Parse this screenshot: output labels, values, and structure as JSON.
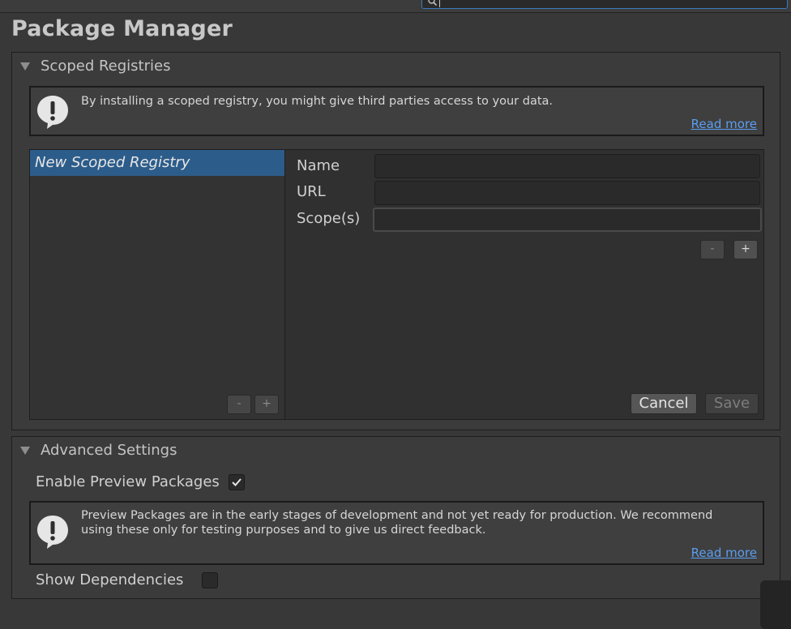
{
  "page": {
    "title": "Package Manager"
  },
  "scoped_registries": {
    "title": "Scoped Registries",
    "help_text": "By installing a scoped registry, you might give third parties access to your data.",
    "read_more": "Read more",
    "list": [
      {
        "label": "New Scoped Registry",
        "selected": true
      }
    ],
    "list_remove": "-",
    "list_add": "+",
    "fields": {
      "name_label": "Name",
      "name_value": "",
      "url_label": "URL",
      "url_value": "",
      "scopes_label": "Scope(s)",
      "scopes_value": ""
    },
    "scope_remove": "-",
    "scope_add": "+",
    "cancel": "Cancel",
    "save": "Save"
  },
  "advanced_settings": {
    "title": "Advanced Settings",
    "enable_preview_label": "Enable Preview Packages",
    "enable_preview_checked": true,
    "preview_help_text": "Preview Packages are in the early stages of development and not yet ready for production. We recommend using these only for testing purposes and to give us direct feedback.",
    "read_more": "Read more",
    "show_dependencies_label": "Show Dependencies",
    "show_dependencies_checked": false
  },
  "colors": {
    "background": "#383838",
    "selection": "#2c5c8a",
    "link": "#5b9ef0",
    "search_focus": "#3a79bb"
  }
}
